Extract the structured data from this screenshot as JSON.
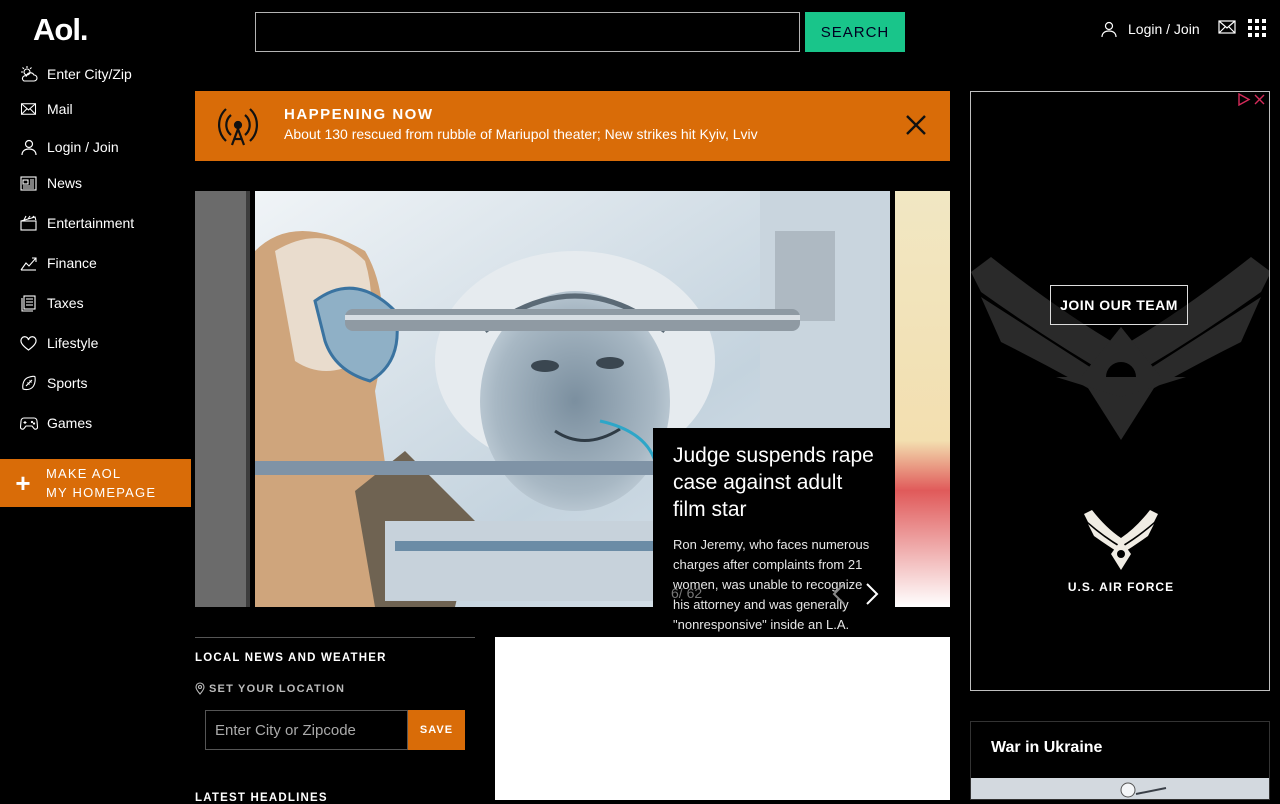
{
  "header": {
    "logo": "Aol.",
    "search": {
      "value": "",
      "placeholder": "",
      "button_label": "SEARCH"
    },
    "login_label": "Login / Join"
  },
  "sidebar": {
    "items": [
      {
        "label": "Enter City/Zip",
        "icon": "weather-icon"
      },
      {
        "label": "Mail",
        "icon": "mail-icon"
      },
      {
        "label": "Login / Join",
        "icon": "user-icon"
      },
      {
        "label": "News",
        "icon": "news-icon"
      },
      {
        "label": "Entertainment",
        "icon": "clapperboard-icon"
      },
      {
        "label": "Finance",
        "icon": "chart-icon"
      },
      {
        "label": "Taxes",
        "icon": "tax-document-icon"
      },
      {
        "label": "Lifestyle",
        "icon": "heart-icon"
      },
      {
        "label": "Sports",
        "icon": "football-icon"
      },
      {
        "label": "Games",
        "icon": "gamepad-icon"
      }
    ],
    "make_homepage": {
      "line1": "MAKE AOL",
      "line2": "MY HOMEPAGE"
    }
  },
  "happening": {
    "title": "HAPPENING NOW",
    "headline": "About 130 rescued from rubble of Mariupol theater; New strikes hit Kyiv, Lviv"
  },
  "slideshow": {
    "title": "Judge suspends rape case against adult film star",
    "description": "Ron Jeremy, who faces numerous charges after complaints from 21 women, was unable to recognize his attorney and was generally \"nonresponsive\" inside an L.A.",
    "counter": "6/ 62"
  },
  "local_news": {
    "title": "LOCAL NEWS AND WEATHER",
    "set_location": "SET YOUR LOCATION",
    "input_placeholder": "Enter City or Zipcode",
    "save_label": "SAVE",
    "latest_headlines": "LATEST HEADLINES"
  },
  "ad": {
    "cta": "JOIN OUR TEAM",
    "brand": "U.S. AIR FORCE"
  },
  "war_section": {
    "title": "War in Ukraine"
  },
  "colors": {
    "accent_orange": "#d96c08",
    "search_green": "#19c58a",
    "background": "#000000"
  }
}
